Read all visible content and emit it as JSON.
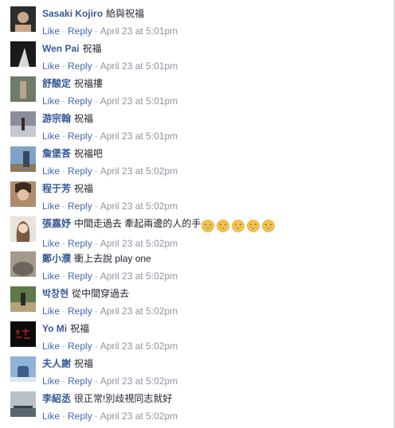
{
  "actions": {
    "like": "Like",
    "reply": "Reply",
    "separator": "·"
  },
  "comments": [
    {
      "author": "Sasaki Kojiro",
      "text": "給與祝福",
      "time": "April 23 at 5:01pm",
      "avatar_colors": [
        "#2d2d2d",
        "#c9a88a"
      ]
    },
    {
      "author": "Wen Pai",
      "text": "祝福",
      "time": "April 23 at 5:01pm",
      "avatar_colors": [
        "#1a1a1a",
        "#d8d8d8"
      ]
    },
    {
      "author": "舒酸定",
      "text": "祝福摟",
      "time": "April 23 at 5:01pm",
      "avatar_colors": [
        "#6f7a6a",
        "#b7a58d"
      ]
    },
    {
      "author": "游宗翰",
      "text": "祝福",
      "time": "April 23 at 5:01pm",
      "avatar_colors": [
        "#8a8f99",
        "#c4c8d0"
      ]
    },
    {
      "author": "詹堡荅",
      "text": "祝福吧",
      "time": "April 23 at 5:02pm",
      "avatar_colors": [
        "#7fa3c8",
        "#3a4a5c"
      ]
    },
    {
      "author": "程于芳",
      "text": "祝福",
      "time": "April 23 at 5:02pm",
      "avatar_colors": [
        "#b08b6c",
        "#3a2a22"
      ]
    },
    {
      "author": "張嘉妤",
      "text": "中間走過去 牽起兩邊的人的手",
      "emoji_count": 5,
      "time": "April 23 at 5:02pm",
      "avatar_colors": [
        "#e8e3dc",
        "#7a5a44"
      ]
    },
    {
      "author": "鄭小濮",
      "text": "衝上去說 play one",
      "time": "April 23 at 5:02pm",
      "avatar_colors": [
        "#a49a8c",
        "#6b655d"
      ]
    },
    {
      "author": "박창현",
      "text": "從中間穿過去",
      "time": "April 23 at 5:02pm",
      "avatar_colors": [
        "#5f7a4a",
        "#b5a37a"
      ]
    },
    {
      "author": "Yo Mi",
      "text": "祝福",
      "time": "April 23 at 5:02pm",
      "avatar_colors": [
        "#0a0a0a",
        "#c02020"
      ]
    },
    {
      "author": "夫人謝",
      "text": "祝福",
      "time": "April 23 at 5:02pm",
      "avatar_colors": [
        "#8fb3d9",
        "#3f5f8a"
      ]
    },
    {
      "author": "李紹丞",
      "text": "很正常!別歧視同志就好",
      "time": "April 23 at 5:02pm",
      "avatar_colors": [
        "#b9c2c9",
        "#5b6770"
      ]
    }
  ],
  "colors": {
    "author_link": "#365899",
    "action_link": "#4267b2",
    "meta": "#90949c",
    "emoji_face": "#f7c443"
  }
}
